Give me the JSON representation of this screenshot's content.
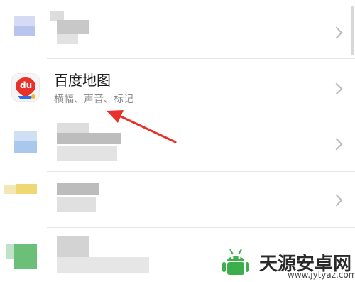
{
  "app_item": {
    "title": "百度地图",
    "subtitle": "横幅、声音、标记",
    "icon": "baidu-map-icon",
    "icon_label": "du"
  },
  "annotation": {
    "type": "arrow",
    "color": "#e8312a"
  },
  "watermark": {
    "site_name": "天源安卓网",
    "url": "www.jytyaz.com",
    "logo": "android-logo",
    "logo_color": "#3cae4c"
  },
  "colors": {
    "chevron": "#b9b9b9",
    "divider": "#e6e6e6"
  }
}
